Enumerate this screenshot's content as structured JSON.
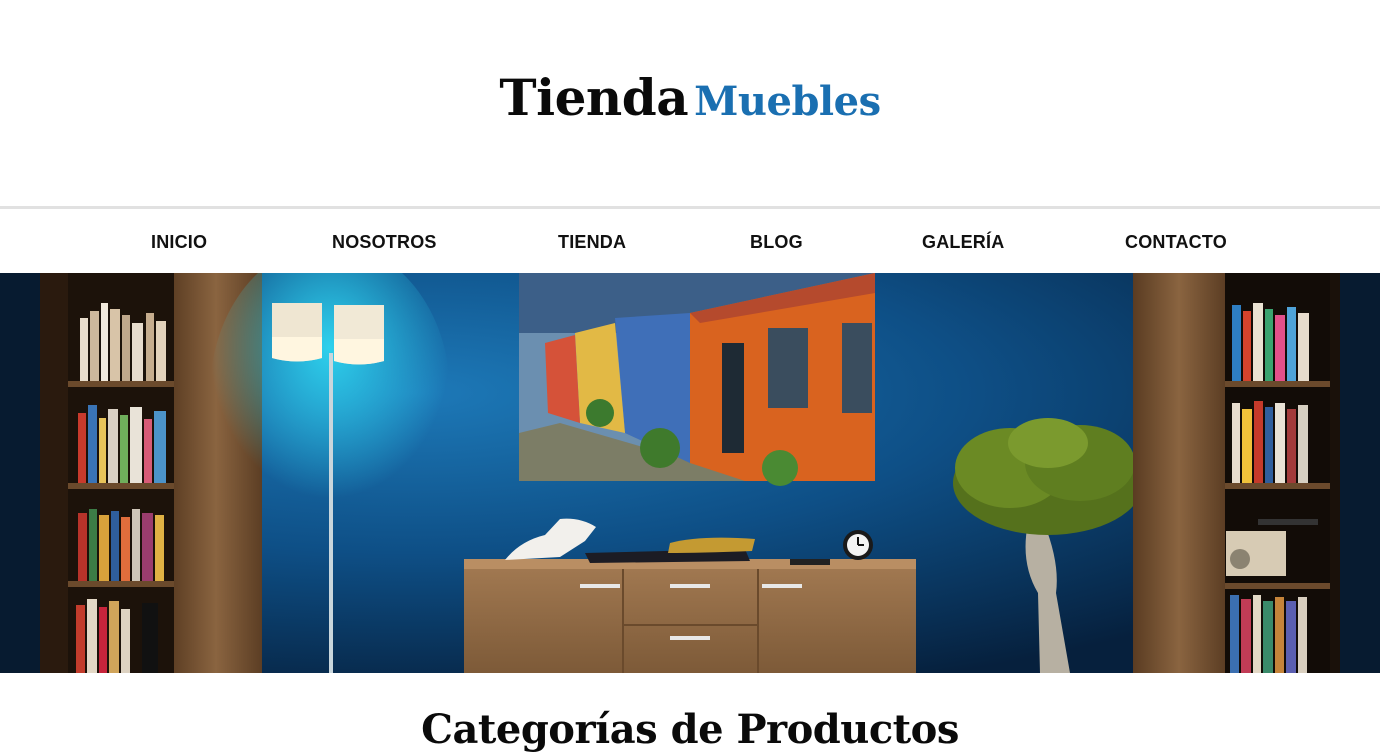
{
  "brand": {
    "word1": "Tienda",
    "word2": "Muebles",
    "accent_color": "#1a6fb1"
  },
  "nav": {
    "items": [
      {
        "label": "INICIO"
      },
      {
        "label": "NOSOTROS"
      },
      {
        "label": "TIENDA"
      },
      {
        "label": "BLOG"
      },
      {
        "label": "GALERÍA"
      },
      {
        "label": "CONTACTO"
      }
    ]
  },
  "hero": {
    "wall_color": "#0e4f86"
  },
  "section": {
    "title": "Categorías de Productos"
  }
}
